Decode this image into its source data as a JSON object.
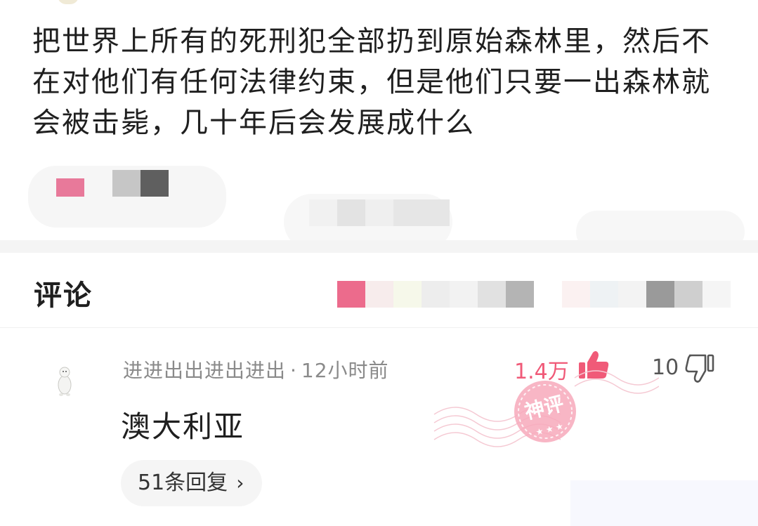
{
  "post": {
    "question_text": "把世界上所有的死刑犯全部扔到原始森林里，然后不在对他们有任何法律约束，但是他们只要一出森林就会被击毙，几十年后会发展成什么"
  },
  "comments_section": {
    "title": "评论"
  },
  "comment": {
    "author": "进进出出进出进出",
    "separator": "·",
    "time": "12小时前",
    "likes": "1.4万",
    "dislikes": "10",
    "text": "澳大利亚",
    "replies_label": "51条回复",
    "replies_chevron": "›",
    "stamp_text": "神评",
    "stamp_color": "#f05a78"
  },
  "icons": {
    "like": "thumbs-up-filled-icon",
    "dislike": "thumbs-down-outline-icon",
    "chevron": "chevron-right-icon"
  },
  "colors": {
    "accent": "#f05a78",
    "meta_gray": "#8a8a8a",
    "pill_bg": "#f5f5f5"
  }
}
